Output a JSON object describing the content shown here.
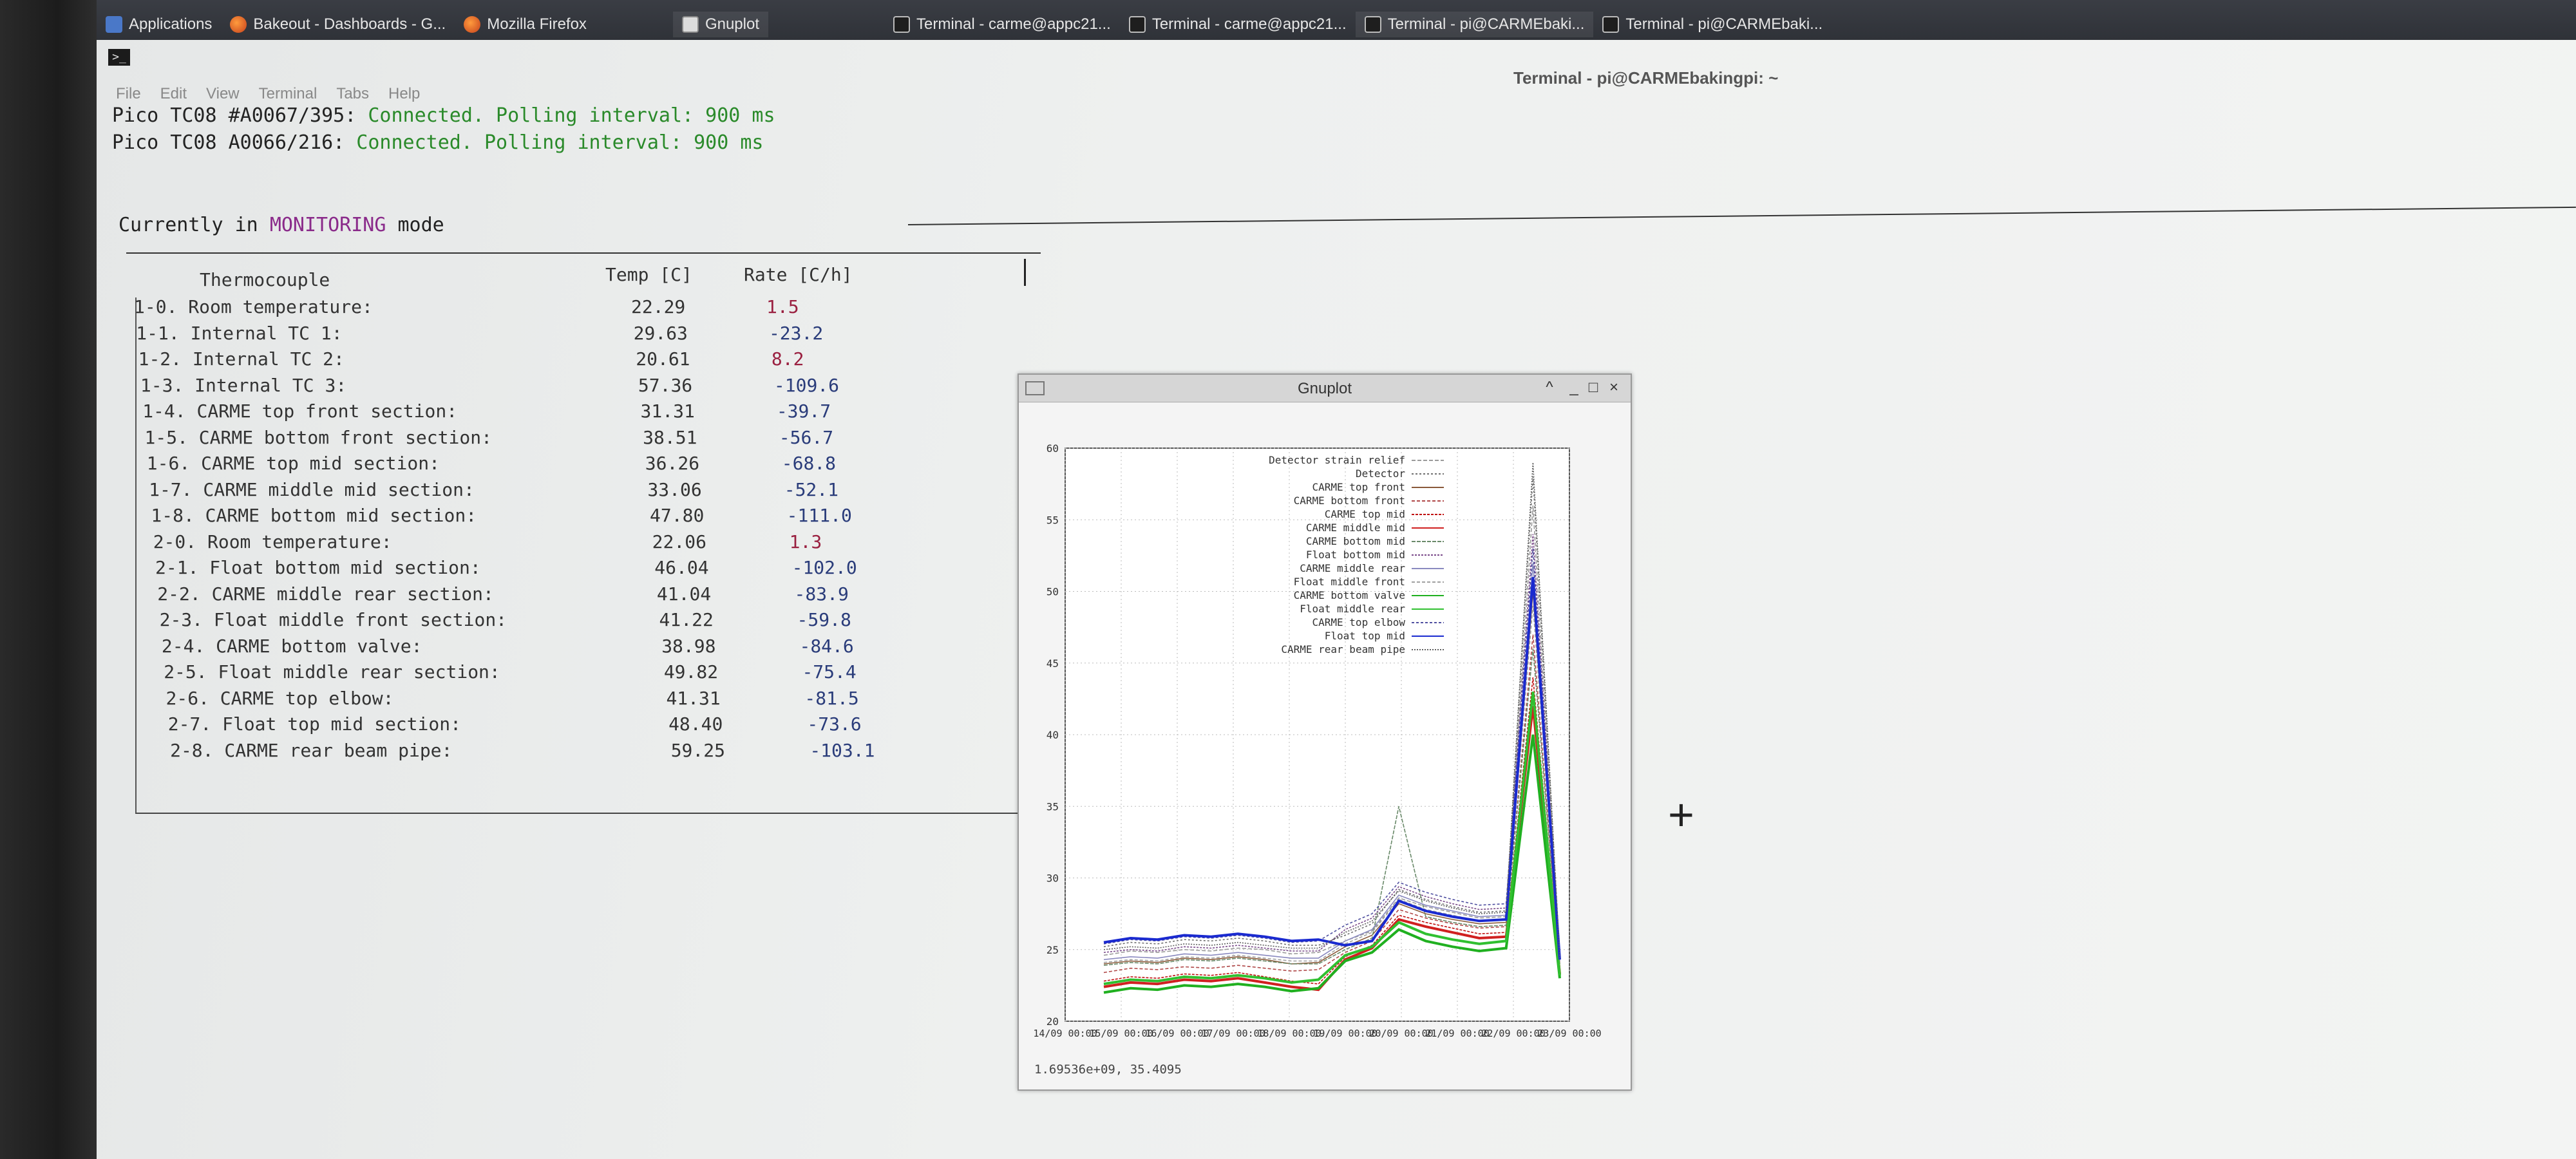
{
  "taskbar": {
    "items": [
      {
        "label": "Applications",
        "icon": "apps-icon"
      },
      {
        "label": "Bakeout - Dashboards - G...",
        "icon": "firefox-icon"
      },
      {
        "label": "Mozilla Firefox",
        "icon": "firefox-icon"
      },
      {
        "label": "Gnuplot",
        "icon": "gnuplot-icon"
      },
      {
        "label": "Terminal - carme@appc21...",
        "icon": "terminal-icon"
      },
      {
        "label": "Terminal - carme@appc21...",
        "icon": "terminal-icon"
      },
      {
        "label": "Terminal - pi@CARMEbaki...",
        "icon": "terminal-icon"
      },
      {
        "label": "Terminal - pi@CARMEbaki...",
        "icon": "terminal-icon"
      }
    ]
  },
  "terminal": {
    "title": "Terminal - pi@CARMEbakingpi: ~",
    "menu": [
      "File",
      "Edit",
      "View",
      "Terminal",
      "Tabs",
      "Help"
    ],
    "status_lines": [
      {
        "prefix": "Pico TC08 #A0067/395: ",
        "status": "Connected. Polling interval: 900 ms"
      },
      {
        "prefix": "Pico TC08 A0066/216: ",
        "status": "Connected. Polling interval: 900 ms"
      }
    ],
    "mode": {
      "prefix": "Currently in ",
      "mode": "MONITORING",
      "suffix": " mode"
    },
    "table": {
      "headers": [
        "Thermocouple",
        "Temp [C]",
        "Rate [C/h]"
      ],
      "rows": [
        {
          "name": "1-0. Room temperature:",
          "temp": "22.29",
          "rate": "1.5"
        },
        {
          "name": "1-1. Internal TC 1:",
          "temp": "29.63",
          "rate": "-23.2"
        },
        {
          "name": "1-2. Internal TC 2:",
          "temp": "20.61",
          "rate": "8.2"
        },
        {
          "name": "1-3. Internal TC 3:",
          "temp": "57.36",
          "rate": "-109.6"
        },
        {
          "name": "1-4. CARME top front section:",
          "temp": "31.31",
          "rate": "-39.7"
        },
        {
          "name": "1-5. CARME bottom front section:",
          "temp": "38.51",
          "rate": "-56.7"
        },
        {
          "name": "1-6. CARME top mid section:",
          "temp": "36.26",
          "rate": "-68.8"
        },
        {
          "name": "1-7. CARME middle mid section:",
          "temp": "33.06",
          "rate": "-52.1"
        },
        {
          "name": "1-8. CARME bottom mid section:",
          "temp": "47.80",
          "rate": "-111.0"
        },
        {
          "name": "2-0. Room temperature:",
          "temp": "22.06",
          "rate": "1.3"
        },
        {
          "name": "2-1. Float bottom mid section:",
          "temp": "46.04",
          "rate": "-102.0"
        },
        {
          "name": "2-2. CARME middle rear section:",
          "temp": "41.04",
          "rate": "-83.9"
        },
        {
          "name": "2-3. Float middle front section:",
          "temp": "41.22",
          "rate": "-59.8"
        },
        {
          "name": "2-4. CARME bottom valve:",
          "temp": "38.98",
          "rate": "-84.6"
        },
        {
          "name": "2-5. Float middle rear section:",
          "temp": "49.82",
          "rate": "-75.4"
        },
        {
          "name": "2-6. CARME top elbow:",
          "temp": "41.31",
          "rate": "-81.5"
        },
        {
          "name": "2-7. Float top mid section:",
          "temp": "48.40",
          "rate": "-73.6"
        },
        {
          "name": "2-8. CARME rear beam pipe:",
          "temp": "59.25",
          "rate": "-103.1"
        }
      ]
    }
  },
  "colors": {
    "status_green": "#2a8a2a",
    "mode_purple": "#8a2a8a",
    "rate_blue": "#2a3c7a",
    "rate_red": "#9a2040"
  },
  "gnuplot": {
    "title": "Gnuplot",
    "status": "1.69536e+09,  35.4095",
    "buttons": [
      "^",
      "_",
      "□",
      "×"
    ]
  },
  "chart_data": {
    "type": "line",
    "ylim": [
      20,
      60
    ],
    "yticks": [
      20,
      25,
      30,
      35,
      40,
      45,
      50,
      55,
      60
    ],
    "xtick_labels": [
      "14/09 00:00",
      "15/09 00:00",
      "16/09 00:00",
      "17/09 00:00",
      "18/09 00:00",
      "19/09 00:00",
      "20/09 00:00",
      "21/09 00:00",
      "22/09 00:00",
      "23/09 00:00"
    ],
    "series": [
      {
        "name": "Detector strain relief",
        "color": "#9a9a9a",
        "dash": "6,3",
        "values": [
          24.6,
          24.9,
          24.8,
          25.0,
          24.9,
          25.1,
          25.0,
          24.7,
          24.8,
          25.6,
          26.3,
          28.6,
          28.0,
          27.6,
          27.2,
          27.3,
          56.0,
          24.3
        ]
      },
      {
        "name": "Detector",
        "color": "#707070",
        "dash": "3,3",
        "values": [
          25.2,
          25.5,
          25.4,
          25.7,
          25.6,
          25.8,
          25.6,
          25.3,
          25.3,
          26.0,
          26.8,
          29.2,
          28.5,
          28.0,
          27.6,
          27.7,
          58.0,
          24.6
        ]
      },
      {
        "name": "CARME top front",
        "color": "#8a5a3a",
        "dash": "",
        "values": [
          24.0,
          24.2,
          24.1,
          24.4,
          24.3,
          24.5,
          24.3,
          24.0,
          24.1,
          25.2,
          26.0,
          28.2,
          27.5,
          27.1,
          26.8,
          26.9,
          50.0,
          24.0
        ]
      },
      {
        "name": "CARME bottom front",
        "color": "#b04848",
        "dash": "5,3",
        "values": [
          23.4,
          23.7,
          23.6,
          23.8,
          23.7,
          23.9,
          23.7,
          23.5,
          23.6,
          24.8,
          25.6,
          27.8,
          27.2,
          26.8,
          26.5,
          26.6,
          47.0,
          23.8
        ]
      },
      {
        "name": "CARME top mid",
        "color": "#c01010",
        "dash": "4,2",
        "values": [
          22.8,
          23.1,
          23.0,
          23.3,
          23.2,
          23.4,
          23.1,
          22.8,
          22.6,
          24.5,
          25.3,
          27.4,
          26.9,
          26.5,
          26.1,
          26.2,
          44.0,
          23.5
        ]
      },
      {
        "name": "CARME middle mid",
        "color": "#d02020",
        "dash": "",
        "values": [
          22.4,
          22.7,
          22.6,
          22.9,
          22.8,
          23.0,
          22.7,
          22.4,
          22.2,
          24.3,
          25.1,
          27.1,
          26.6,
          26.2,
          25.8,
          25.9,
          42.0,
          23.3
        ]
      },
      {
        "name": "CARME bottom mid",
        "color": "#6a8a6a",
        "dash": "6,2",
        "values": [
          23.9,
          24.1,
          24.0,
          24.3,
          24.2,
          24.4,
          24.2,
          24.0,
          24.0,
          25.0,
          25.8,
          35.0,
          27.3,
          26.9,
          26.6,
          26.7,
          46.0,
          23.9
        ]
      },
      {
        "name": "Float bottom mid",
        "color": "#7a4a8a",
        "dash": "3,2",
        "values": [
          24.8,
          25.0,
          24.9,
          25.2,
          25.1,
          25.3,
          25.1,
          24.9,
          24.9,
          26.4,
          27.2,
          29.4,
          28.7,
          28.2,
          27.8,
          27.9,
          54.0,
          24.4
        ]
      },
      {
        "name": "CARME middle rear",
        "color": "#8a8ac0",
        "dash": "",
        "values": [
          24.3,
          24.5,
          24.4,
          24.7,
          24.6,
          24.8,
          24.6,
          24.4,
          24.4,
          25.6,
          26.4,
          28.8,
          28.1,
          27.7,
          27.3,
          27.4,
          52.0,
          24.2
        ]
      },
      {
        "name": "Float middle front",
        "color": "#a0a0a0",
        "dash": "5,3",
        "values": [
          24.1,
          24.3,
          24.2,
          24.5,
          24.4,
          24.6,
          24.4,
          24.2,
          24.2,
          25.4,
          26.2,
          28.5,
          27.8,
          27.4,
          27.0,
          27.1,
          49.0,
          24.1
        ]
      },
      {
        "name": "CARME bottom valve",
        "color": "#20b020",
        "dash": "",
        "values": [
          22.0,
          22.3,
          22.2,
          22.5,
          22.4,
          22.6,
          22.4,
          22.1,
          22.3,
          24.2,
          24.8,
          26.4,
          25.6,
          25.2,
          24.9,
          25.1,
          40.0,
          23.0
        ]
      },
      {
        "name": "Float middle rear",
        "color": "#30c030",
        "dash": "",
        "values": [
          22.6,
          22.9,
          22.8,
          23.1,
          23.0,
          23.2,
          23.0,
          22.7,
          22.9,
          24.6,
          25.2,
          26.9,
          26.1,
          25.7,
          25.4,
          25.6,
          43.0,
          23.2
        ]
      },
      {
        "name": "CARME top elbow",
        "color": "#5050a0",
        "dash": "4,3",
        "values": [
          25.4,
          25.7,
          25.6,
          25.9,
          25.8,
          26.0,
          25.8,
          25.5,
          25.6,
          26.7,
          27.5,
          29.7,
          29.0,
          28.5,
          28.1,
          28.2,
          53.0,
          24.5
        ]
      },
      {
        "name": "Float top mid",
        "color": "#1a2ad0",
        "dash": "",
        "values": [
          25.5,
          25.8,
          25.7,
          26.0,
          25.9,
          26.1,
          25.9,
          25.6,
          25.7,
          25.3,
          25.6,
          28.4,
          27.7,
          27.3,
          27.0,
          27.1,
          51.0,
          24.3
        ]
      },
      {
        "name": "CARME rear beam pipe",
        "color": "#606060",
        "dash": "2,2",
        "values": [
          25.0,
          25.2,
          25.1,
          25.4,
          25.3,
          25.5,
          25.3,
          25.1,
          25.1,
          26.2,
          27.0,
          29.1,
          28.4,
          27.9,
          27.5,
          27.6,
          59.0,
          24.4
        ]
      }
    ]
  }
}
